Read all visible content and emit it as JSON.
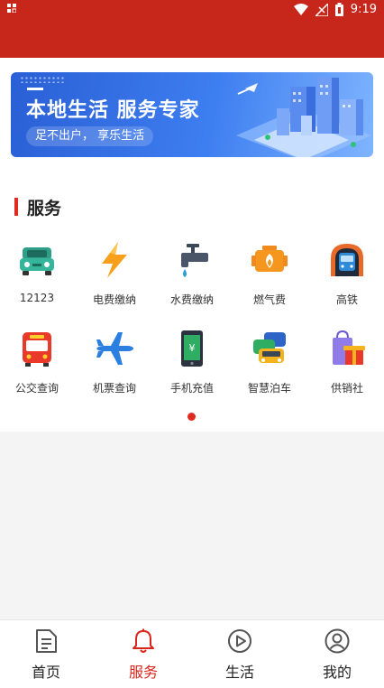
{
  "status_bar": {
    "left_icon": "notification-icon",
    "time": "9:19"
  },
  "banner": {
    "title": "本地生活  服务专家",
    "subtitle": "足不出户，  享乐生活"
  },
  "section": {
    "title": "服务"
  },
  "services": [
    {
      "label": "12123",
      "icon": "car-icon"
    },
    {
      "label": "电费缴纳",
      "icon": "lightning-icon"
    },
    {
      "label": "水费缴纳",
      "icon": "water-tap-icon"
    },
    {
      "label": "燃气费",
      "icon": "gas-engine-icon"
    },
    {
      "label": "高铁",
      "icon": "train-icon"
    },
    {
      "label": "公交查询",
      "icon": "bus-icon"
    },
    {
      "label": "机票查询",
      "icon": "airplane-icon"
    },
    {
      "label": "手机充值",
      "icon": "phone-recharge-icon"
    },
    {
      "label": "智慧泊车",
      "icon": "parking-cars-icon"
    },
    {
      "label": "供销社",
      "icon": "shopping-gift-icon"
    }
  ],
  "pager": {
    "pages": 1,
    "current": 1
  },
  "tabs": [
    {
      "label": "首页",
      "icon": "document-icon",
      "active": false
    },
    {
      "label": "服务",
      "icon": "bell-icon",
      "active": true
    },
    {
      "label": "生活",
      "icon": "play-circle-icon",
      "active": false
    },
    {
      "label": "我的",
      "icon": "user-icon",
      "active": false
    }
  ],
  "colors": {
    "brand_red": "#c7261b",
    "accent_red": "#e02b20",
    "banner_blue": "#2a5fd6"
  }
}
